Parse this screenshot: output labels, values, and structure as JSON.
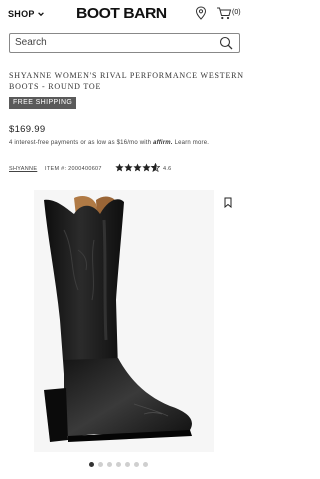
{
  "header": {
    "shop_label": "SHOP",
    "logo_text": "BOOT BARN",
    "cart_count": "(0)"
  },
  "search": {
    "placeholder": "Search"
  },
  "product": {
    "title": "SHYANNE WOMEN'S RIVAL PERFORMANCE WESTERN BOOTS - ROUND TOE",
    "badge": "FREE SHIPPING",
    "price": "$169.99",
    "installments_text": "4 interest-free payments or as low as $16/mo with",
    "affirm_label": "affirm.",
    "learn_more": "Learn more.",
    "brand": "SHYANNE",
    "item_number": "ITEM #: 2000400607",
    "rating_value": 4.6,
    "rating_text": "4.6"
  },
  "carousel": {
    "total": 7,
    "active_index": 0
  },
  "colors": {
    "badge_bg": "#5a5a5a",
    "boot": "#1a1a1a",
    "lining": "#b07a45"
  }
}
